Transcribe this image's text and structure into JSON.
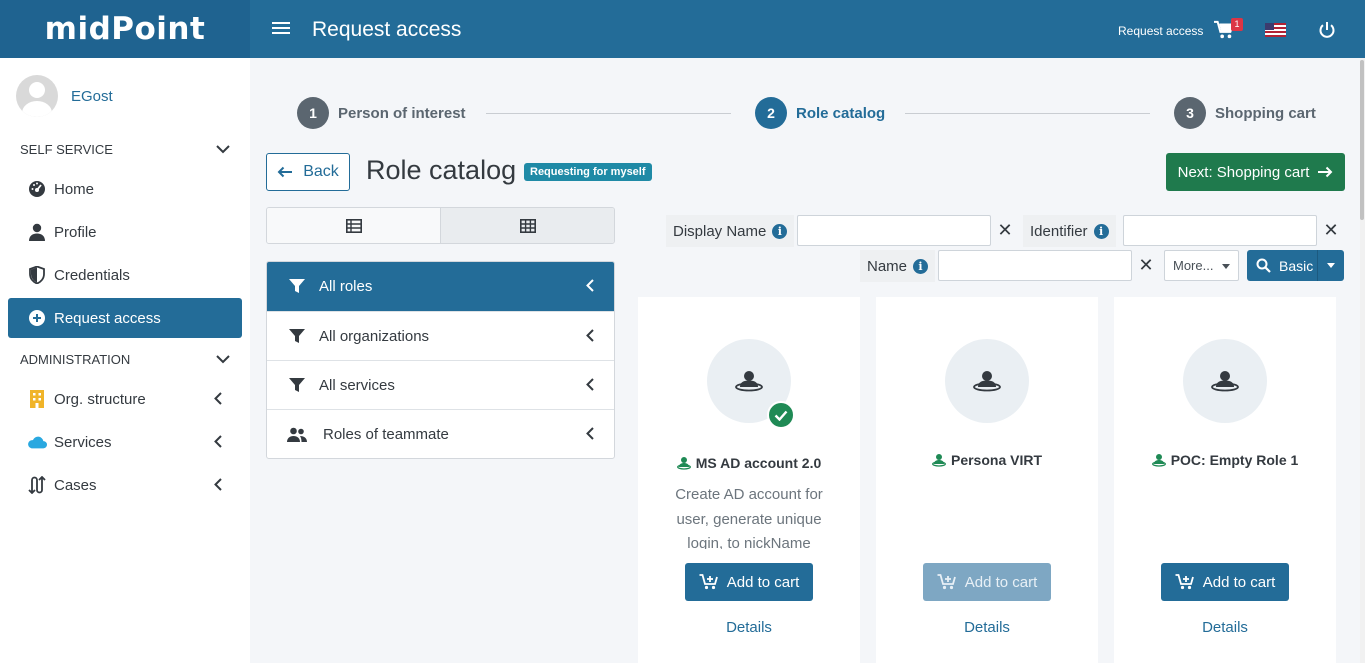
{
  "header": {
    "logo": "midPoint",
    "title": "Request access",
    "request_access_link": "Request access",
    "cart_count": "1"
  },
  "sidebar": {
    "user_name": "EGost",
    "self_service_title": "SELF SERVICE",
    "administration_title": "ADMINISTRATION",
    "items": [
      {
        "label": "Home"
      },
      {
        "label": "Profile"
      },
      {
        "label": "Credentials"
      },
      {
        "label": "Request access"
      },
      {
        "label": "Org. structure"
      },
      {
        "label": "Services"
      },
      {
        "label": "Cases"
      }
    ]
  },
  "steps": [
    {
      "num": "1",
      "label": "Person of interest"
    },
    {
      "num": "2",
      "label": "Role catalog"
    },
    {
      "num": "3",
      "label": "Shopping cart"
    }
  ],
  "page": {
    "back_label": "Back",
    "title": "Role catalog",
    "badge": "Requesting for myself",
    "next_label": "Next: Shopping cart"
  },
  "menu": [
    {
      "label": "All roles"
    },
    {
      "label": "All organizations"
    },
    {
      "label": "All services"
    },
    {
      "label": "Roles of teammate"
    }
  ],
  "search": {
    "display_name_label": "Display Name",
    "identifier_label": "Identifier",
    "name_label": "Name",
    "display_name_value": "",
    "identifier_value": "",
    "name_value": "",
    "more_label": "More...",
    "basic_label": "Basic"
  },
  "cards": [
    {
      "name": "MS AD account 2.0",
      "desc": "Create AD account for user, generate unique login, to nickName",
      "add_label": "Add to cart",
      "details": "Details"
    },
    {
      "name": "Persona VIRT",
      "desc": "",
      "add_label": "Add to cart",
      "details": "Details"
    },
    {
      "name": "POC: Empty Role 1",
      "desc": "",
      "add_label": "Add to cart",
      "details": "Details"
    }
  ],
  "colors": {
    "primary": "#236c98",
    "success": "#1f7a4d",
    "info": "#1f8aa6"
  }
}
